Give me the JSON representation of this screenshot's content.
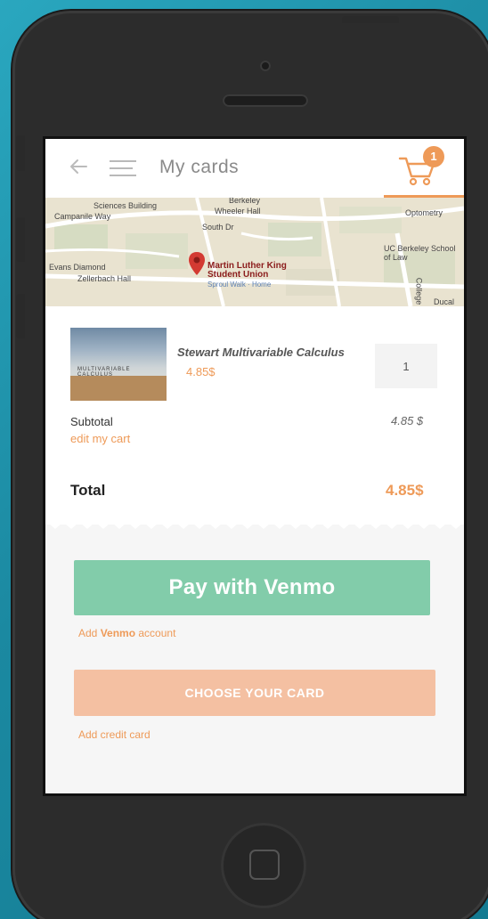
{
  "header": {
    "title": "My cards",
    "cart_count": "1"
  },
  "map": {
    "labels": {
      "sciences_building": "Sciences Building",
      "campanile_way": "Campanile Way",
      "berkeley": "Berkeley",
      "wheeler_hall": "Wheeler Hall",
      "south_dr": "South Dr",
      "optometry": "Optometry",
      "evans_diamond": "Evans Diamond",
      "zellerbach_hall": "Zellerbach Hall",
      "uc_berkeley_law": "UC Berkeley School of Law",
      "college": "College",
      "ducal": "Ducal"
    },
    "pin_label": "Martin Luther King Student Union",
    "pin_sub": "Sproul Walk · Home"
  },
  "cart": {
    "product_title": "Stewart Multivariable Calculus",
    "product_price": "4.85$",
    "quantity": "1",
    "book_cover_text": "MULTIVARIABLE CALCULUS",
    "subtotal_label": "Subtotal",
    "subtotal_value": "4.85 $",
    "edit_label": "edit my cart",
    "total_label": "Total",
    "total_value": "4.85$"
  },
  "payment": {
    "venmo_button": "Pay with Venmo",
    "add_venmo_prefix": "Add ",
    "add_venmo_brand": "Venmo",
    "add_venmo_suffix": " account",
    "card_button": "CHOOSE YOUR CARD",
    "add_card": "Add credit card"
  },
  "colors": {
    "accent": "#ee9a58",
    "venmo": "#82ccaa",
    "card": "#f4c0a2",
    "background": "#1f8fa6"
  },
  "icons": {
    "back": "arrow-left-icon",
    "menu": "hamburger-menu-icon",
    "cart": "shopping-cart-icon",
    "pin": "map-pin-icon"
  }
}
